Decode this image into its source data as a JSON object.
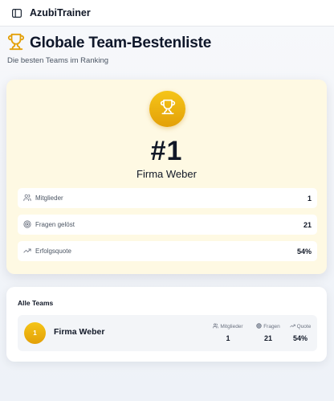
{
  "app": {
    "title": "AzubiTrainer",
    "sidebar_toggle_icon": "sidebar-toggle-icon"
  },
  "page": {
    "title": "Globale Team-Bestenliste",
    "subtitle": "Die besten Teams im Ranking",
    "title_icon": "trophy-icon"
  },
  "winner": {
    "rank": "#1",
    "name": "Firma Weber",
    "icon": "trophy-icon",
    "stats": [
      {
        "icon": "users-icon",
        "label": "Mitglieder",
        "value": "1"
      },
      {
        "icon": "target-icon",
        "label": "Fragen gelöst",
        "value": "21"
      },
      {
        "icon": "trending-up-icon",
        "label": "Erfolgsquote",
        "value": "54%"
      }
    ]
  },
  "teams": {
    "title": "Alle Teams",
    "rows": [
      {
        "rank": "1",
        "name": "Firma Weber",
        "stats": [
          {
            "icon": "users-icon",
            "label": "Mitglieder",
            "value": "1"
          },
          {
            "icon": "target-icon",
            "label": "Fragen",
            "value": "21"
          },
          {
            "icon": "trending-up-icon",
            "label": "Quote",
            "value": "54%"
          }
        ]
      }
    ]
  },
  "colors": {
    "gold": "#f5c518",
    "gold_dark": "#e3a008",
    "winner_card_bg": "#fef9e3",
    "text_dark": "#111827",
    "text_muted": "#4b5563"
  }
}
